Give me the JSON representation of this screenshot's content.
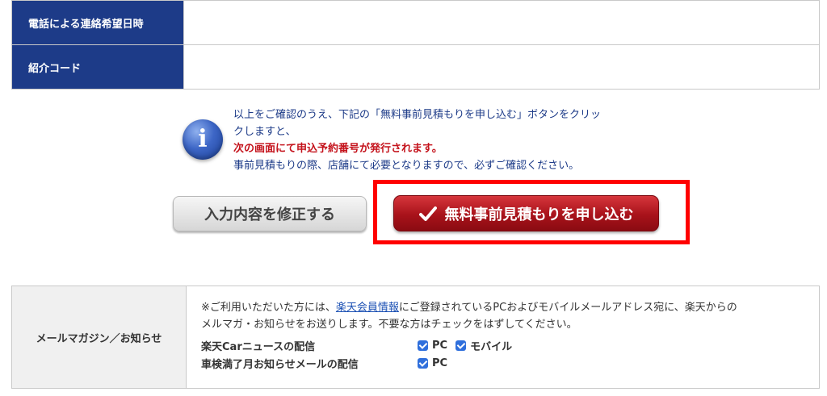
{
  "top_table": {
    "rows": [
      {
        "label": "電話による連絡希望日時",
        "value": ""
      },
      {
        "label": "紹介コード",
        "value": ""
      }
    ]
  },
  "notice": {
    "icon": "info-icon",
    "icon_glyph": "i",
    "line1": "以上をご確認のうえ、下記の「無料事前見積もりを申し込む」ボタンをクリッ",
    "line2": "クしますと、",
    "line3_red": "次の画面にて申込予約番号が発行されます。",
    "line4": "事前見積もりの際、店舗にて必要となりますので、必ずご確認ください。"
  },
  "buttons": {
    "edit_label": "入力内容を修正する",
    "submit_label": "無料事前見積もりを申し込む"
  },
  "colors": {
    "header_blue": "#1d3b88",
    "submit_red": "#a8121a",
    "highlight": "#ff0000",
    "link": "#1a4fb3"
  },
  "mail_magazine": {
    "label": "メールマガジン／お知らせ",
    "desc_prefix": "※ご利用いただいた方には、",
    "desc_link": "楽天会員情報",
    "desc_suffix": "にご登録されているPCおよびモバイルメールアドレス宛に、楽天からの",
    "desc_line2": "メルマガ・お知らせをお送りします。不要な方はチェックをはずしてください。",
    "options": [
      {
        "label": "楽天Carニュースの配信",
        "checks": [
          {
            "text": "PC",
            "checked": true
          },
          {
            "text": "モバイル",
            "checked": true
          }
        ]
      },
      {
        "label": "車検満了月お知らせメールの配信",
        "checks": [
          {
            "text": "PC",
            "checked": true
          }
        ]
      }
    ]
  }
}
